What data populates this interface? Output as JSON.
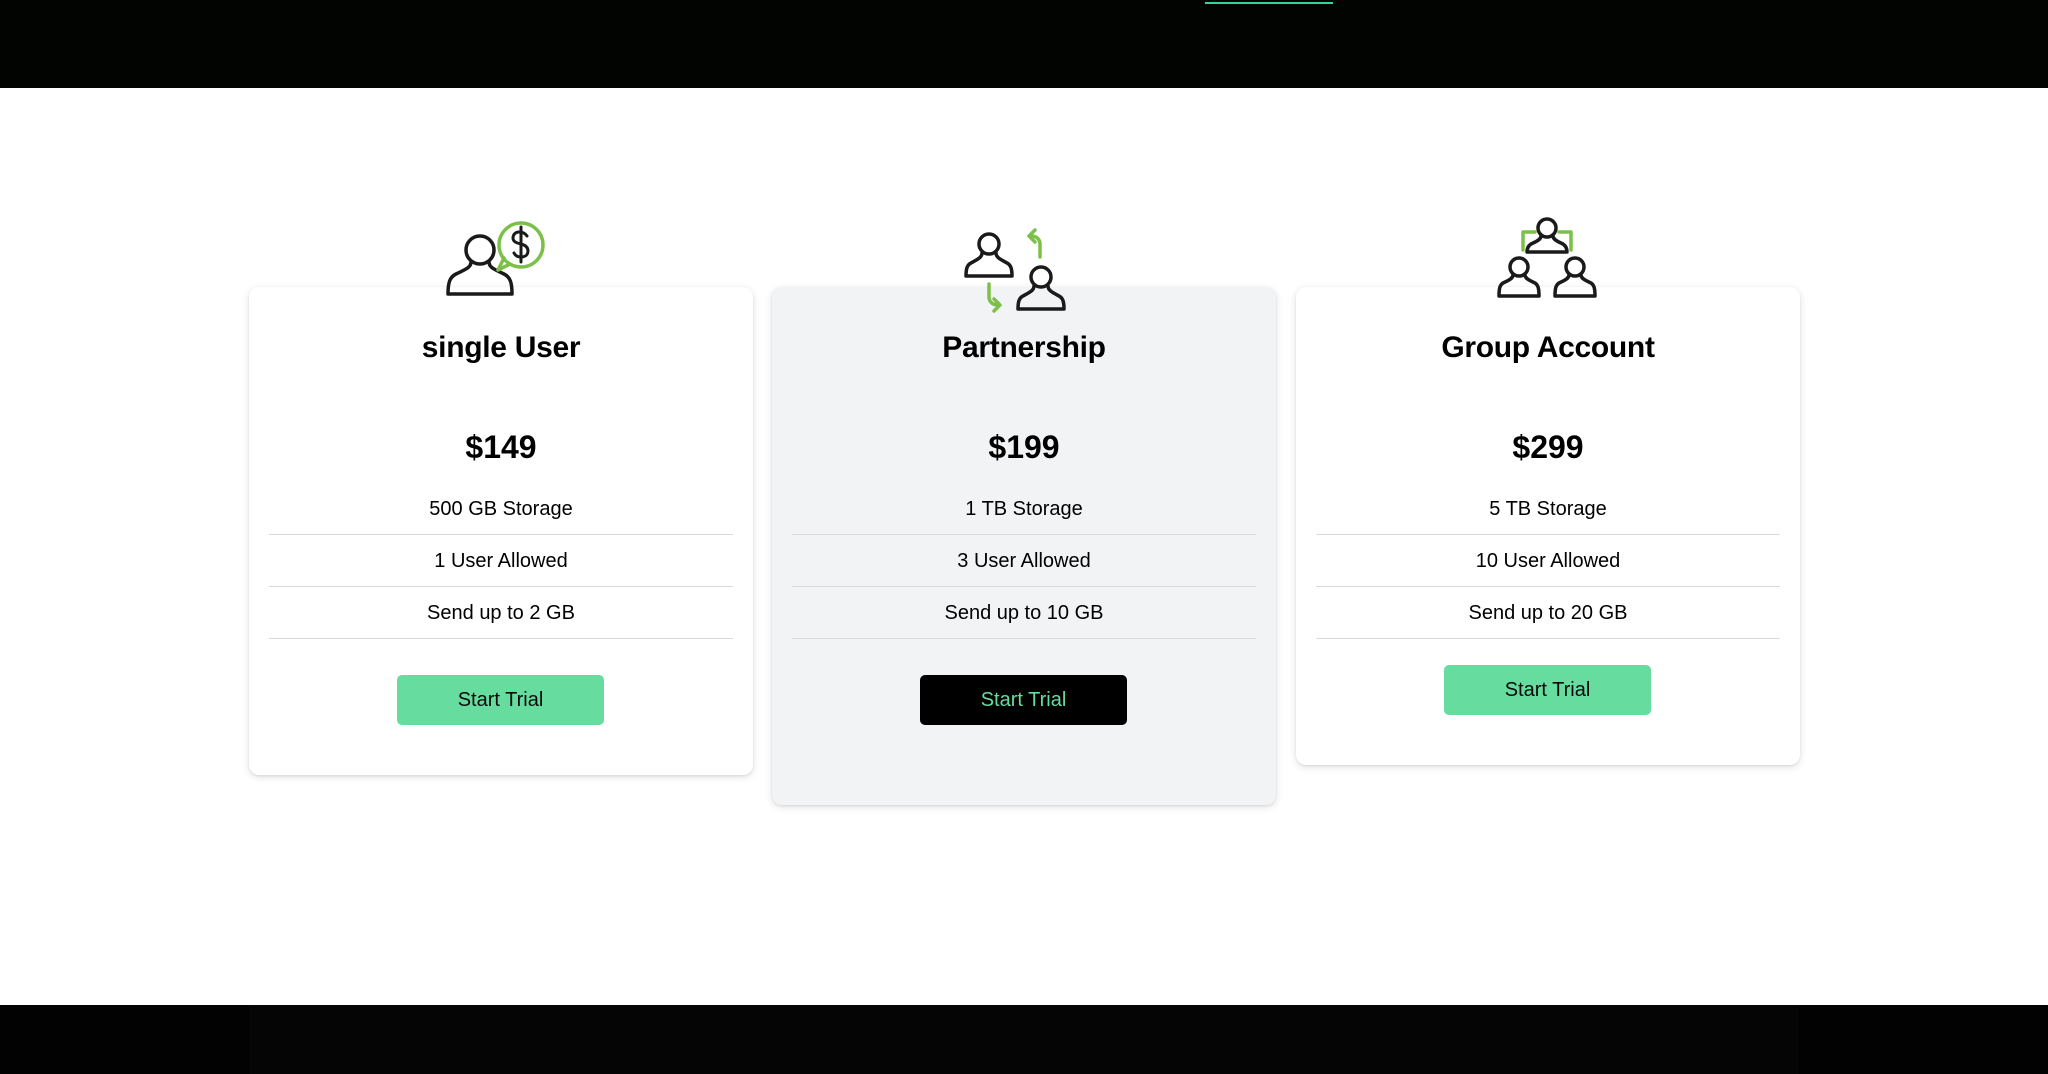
{
  "header": {
    "link_fragment": ""
  },
  "colors": {
    "accent_green": "#66dc9f",
    "icon_green": "#7cc04a",
    "dark": "#000000",
    "highlight_card": "#f2f3f5"
  },
  "plans": [
    {
      "icon": "user-dollar-icon",
      "title": "single User",
      "price": "$149",
      "features": [
        "500 GB Storage",
        "1 User Allowed",
        "Send up to 2 GB"
      ],
      "button_label": "Start Trial"
    },
    {
      "icon": "partnership-exchange-icon",
      "title": "Partnership",
      "price": "$199",
      "features": [
        "1 TB Storage",
        "3 User Allowed",
        "Send up to 10 GB"
      ],
      "button_label": "Start Trial"
    },
    {
      "icon": "group-users-icon",
      "title": "Group Account",
      "price": "$299",
      "features": [
        "5 TB Storage",
        "10 User Allowed",
        "Send up to 20 GB"
      ],
      "button_label": "Start Trial"
    }
  ]
}
